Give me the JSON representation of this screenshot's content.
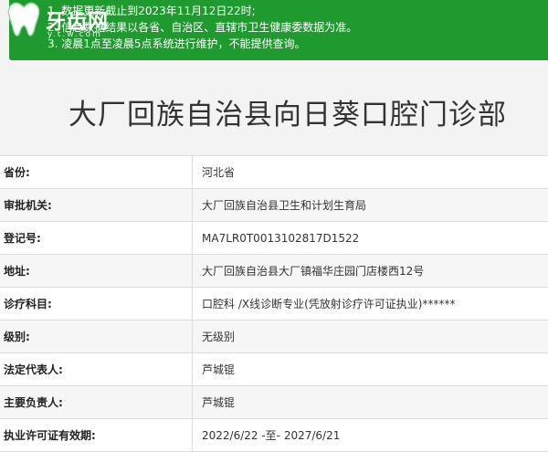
{
  "notice": {
    "lines": [
      "1. 数据更新截止到2023年11月12日22时;",
      "2. 信息数据结果以各省、自治区、直辖市卫生健康委数据为准。",
      "3. 凌晨1点至凌晨5点系统进行维护，不能提供查询。"
    ]
  },
  "logo": {
    "text": "牙齿网",
    "url": "y.t.w.com"
  },
  "page_title": "大厂回族自治县向日葵口腔门诊部",
  "rows": [
    {
      "label": "省份:",
      "value": "河北省"
    },
    {
      "label": "审批机关:",
      "value": "大厂回族自治县卫生和计划生育局"
    },
    {
      "label": "登记号:",
      "value": "MA7LR0T0013102817D1522"
    },
    {
      "label": "地址:",
      "value": "大厂回族自治县大厂镇福华庄园门店楼西12号"
    },
    {
      "label": "诊疗科目:",
      "value": "口腔科 /X线诊断专业(凭放射诊疗许可证执业)******"
    },
    {
      "label": "级别:",
      "value": "无级别"
    },
    {
      "label": "法定代表人:",
      "value": "芦城锟"
    },
    {
      "label": "主要负责人:",
      "value": "芦城锟"
    },
    {
      "label": "执业许可证有效期:",
      "value": "2022/6/22 -至- 2027/6/21"
    }
  ]
}
